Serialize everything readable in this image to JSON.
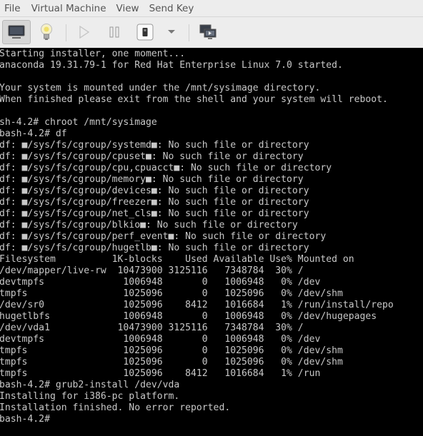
{
  "menubar": {
    "items": [
      "File",
      "Virtual Machine",
      "View",
      "Send Key"
    ]
  },
  "toolbar": {
    "buttons": [
      {
        "icon": "monitor-icon",
        "state": "active"
      },
      {
        "icon": "lightbulb-icon"
      },
      {
        "icon": "play-icon",
        "state": "disabled"
      },
      {
        "icon": "pause-icon"
      },
      {
        "icon": "power-icon"
      },
      {
        "icon": "chevron-down-icon"
      },
      {
        "icon": "console-screens-icon"
      }
    ]
  },
  "terminal": {
    "lines_before": [
      "Starting installer, one moment...",
      "anaconda 19.31.79-1 for Red Hat Enterprise Linux 7.0 started.",
      "",
      "Your system is mounted under the /mnt/sysimage directory.",
      "When finished please exit from the shell and your system will reboot.",
      "",
      "sh-4.2# chroot /mnt/sysimage",
      "bash-4.2# df",
      "df: ■/sys/fs/cgroup/systemd■: No such file or directory",
      "df: ■/sys/fs/cgroup/cpuset■: No such file or directory",
      "df: ■/sys/fs/cgroup/cpu,cpuacct■: No such file or directory",
      "df: ■/sys/fs/cgroup/memory■: No such file or directory",
      "df: ■/sys/fs/cgroup/devices■: No such file or directory",
      "df: ■/sys/fs/cgroup/freezer■: No such file or directory",
      "df: ■/sys/fs/cgroup/net_cls■: No such file or directory",
      "df: ■/sys/fs/cgroup/blkio■: No such file or directory",
      "df: ■/sys/fs/cgroup/perf_event■: No such file or directory",
      "df: ■/sys/fs/cgroup/hugetlb■: No such file or directory"
    ],
    "df_table": {
      "headers": [
        "Filesystem",
        "1K-blocks",
        "Used",
        "Available",
        "Use%",
        "Mounted on"
      ],
      "rows": [
        [
          "/dev/mapper/live-rw",
          "10473900",
          "3125116",
          "7348784",
          "30%",
          "/"
        ],
        [
          "devtmpfs",
          "1006948",
          "0",
          "1006948",
          "0%",
          "/dev"
        ],
        [
          "tmpfs",
          "1025096",
          "0",
          "1025096",
          "0%",
          "/dev/shm"
        ],
        [
          "/dev/sr0",
          "1025096",
          "8412",
          "1016684",
          "1%",
          "/run/install/repo"
        ],
        [
          "hugetlbfs",
          "1006948",
          "0",
          "1006948",
          "0%",
          "/dev/hugepages"
        ],
        [
          "/dev/vda1",
          "10473900",
          "3125116",
          "7348784",
          "30%",
          "/"
        ],
        [
          "devtmpfs",
          "1006948",
          "0",
          "1006948",
          "0%",
          "/dev"
        ],
        [
          "tmpfs",
          "1025096",
          "0",
          "1025096",
          "0%",
          "/dev/shm"
        ],
        [
          "tmpfs",
          "1025096",
          "0",
          "1025096",
          "0%",
          "/dev/shm"
        ],
        [
          "tmpfs",
          "1025096",
          "8412",
          "1016684",
          "1%",
          "/run"
        ]
      ]
    },
    "lines_after": [
      "bash-4.2# grub2-install /dev/vda",
      "Installing for i386-pc platform.",
      "Installation finished. No error reported.",
      "bash-4.2#"
    ]
  }
}
